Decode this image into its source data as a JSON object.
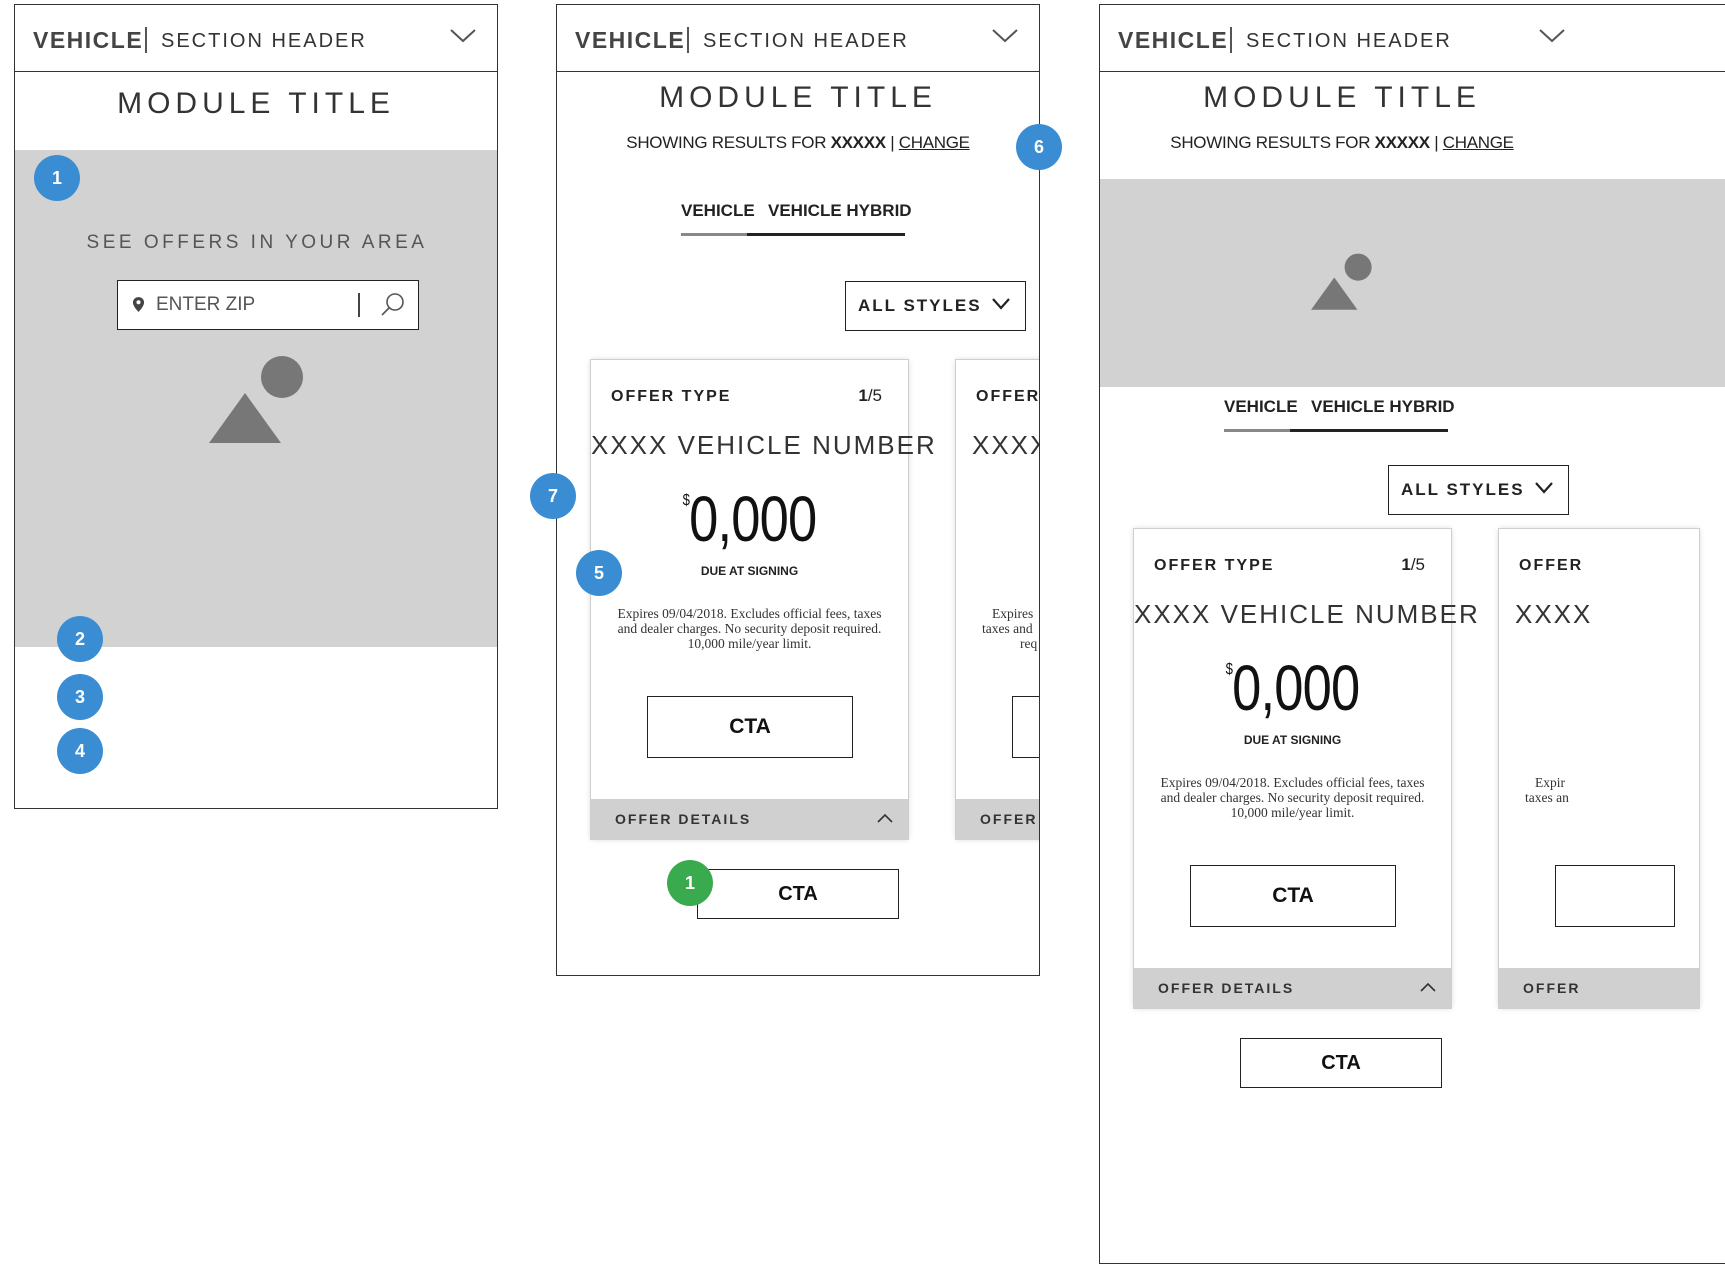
{
  "header": {
    "brand": "VEHICLE",
    "section": "SECTION HEADER",
    "icon": "chevron-down-icon"
  },
  "frame1": {
    "module_title": "MODULE TITLE",
    "offers_text": "SEE OFFERS IN YOUR AREA",
    "zip_placeholder": "ENTER ZIP",
    "badges": [
      "1",
      "2",
      "3",
      "4"
    ]
  },
  "showing": {
    "prefix": "SHOWING RESULTS FOR ",
    "value": "XXXXX",
    "sep": " | ",
    "link": "CHANGE"
  },
  "tabs": [
    "VEHICLE",
    "VEHICLE HYBRID"
  ],
  "select": {
    "value": "ALL STYLES"
  },
  "offer_card": {
    "type": "OFFER TYPE",
    "index": "1",
    "total": "/5",
    "vehicle": "XXXX VEHICLE NUMBER",
    "currency": "$",
    "price": "0,000",
    "due": "DUE AT SIGNING",
    "disclaimer": "Expires 09/04/2018. Excludes official fees, taxes and dealer  charges. No security deposit required. 10,000 mile/year limit.",
    "cta": "CTA",
    "details": "OFFER DETAILS",
    "peek_type": "OFFER",
    "peek_vehicle": "XXXX",
    "peek_details": "OFFER D",
    "peek_details3": "OFFER",
    "peek_disc_1": "Expires",
    "peek_disc_2": "taxes and",
    "peek_disc_3": "req",
    "peek3_type": "OFFER",
    "peek3_vehicle": "XXXX",
    "peek3_disc_1": "Expir",
    "peek3_disc_2": "taxes an"
  },
  "frame2": {
    "module_title": "MODULE TITLE",
    "cta": "CTA",
    "badges": {
      "b6": "6",
      "b7": "7",
      "b5": "5",
      "g1": "1"
    }
  },
  "frame3": {
    "module_title": "MODULE TITLE",
    "cta": "CTA"
  },
  "colors": {
    "badge_blue": "#3a8dd3",
    "badge_green": "#3aaa4e",
    "placeholder_grey": "#d2d2d2"
  }
}
